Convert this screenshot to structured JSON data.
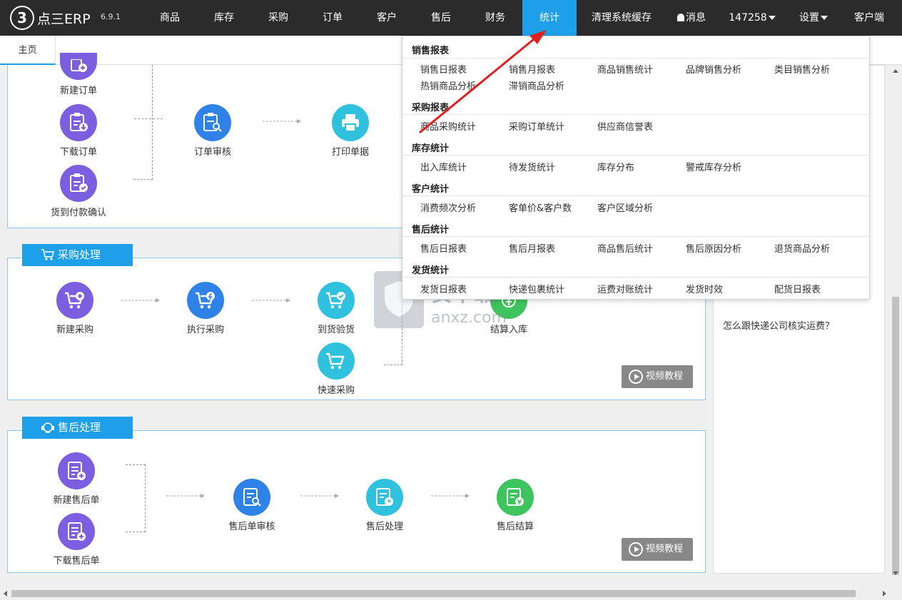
{
  "app": {
    "logo_text": "点三ERP",
    "logo_mark": "3",
    "version": "6.9.1"
  },
  "nav": {
    "items": [
      "商品",
      "库存",
      "采购",
      "订单",
      "客户",
      "售后",
      "财务",
      "统计",
      "清理系统缓存"
    ],
    "active": "统计",
    "messages": "消息",
    "user": "147258",
    "settings": "设置",
    "client": "客户端"
  },
  "tabs": {
    "home": "主页"
  },
  "order_flow": {
    "nodes": [
      "新建订单",
      "下载订单",
      "货到付款确认",
      "订单审核",
      "打印单据"
    ]
  },
  "purchase": {
    "title": "采购处理",
    "nodes": [
      "新建采购",
      "执行采购",
      "到货验货",
      "快速采购",
      "结算入库"
    ],
    "video": "视频教程"
  },
  "aftersale": {
    "title": "售后处理",
    "nodes": [
      "新建售后单",
      "下载售后单",
      "售后单审核",
      "售后处理",
      "售后结算"
    ],
    "video": "视频教程"
  },
  "sidebar": {
    "link": "怎么跟快递公司核实运费？"
  },
  "dropdown": {
    "sections": [
      {
        "title": "销售报表",
        "items": [
          "销售日报表",
          "销售月报表",
          "商品销售统计",
          "品牌销售分析",
          "类目销售分析",
          "热销商品分析",
          "滞销商品分析"
        ]
      },
      {
        "title": "采购报表",
        "items": [
          "商品采购统计",
          "采购订单统计",
          "供应商信誉表"
        ]
      },
      {
        "title": "库存统计",
        "items": [
          "出入库统计",
          "待发货统计",
          "库存分布",
          "警戒库存分析"
        ]
      },
      {
        "title": "客户统计",
        "items": [
          "消费频次分析",
          "客单价&客户数",
          "客户区域分析"
        ]
      },
      {
        "title": "售后统计",
        "items": [
          "售后日报表",
          "售后月报表",
          "商品售后统计",
          "售后原因分析",
          "退货商品分析"
        ]
      },
      {
        "title": "发货统计",
        "items": [
          "发货日报表",
          "快递包裹统计",
          "运费对账统计",
          "发货时效",
          "配货日报表"
        ]
      }
    ]
  },
  "watermark": {
    "text": "安下载",
    "sub": "anxz.com"
  },
  "colors": {
    "accent": "#1e9fea",
    "topbar": "#2b2b2b",
    "purple": "#7b5fe0",
    "blue": "#2f83e8",
    "cyan": "#2fc1dd",
    "green": "#3ec45c",
    "arrow": "#e02020"
  }
}
